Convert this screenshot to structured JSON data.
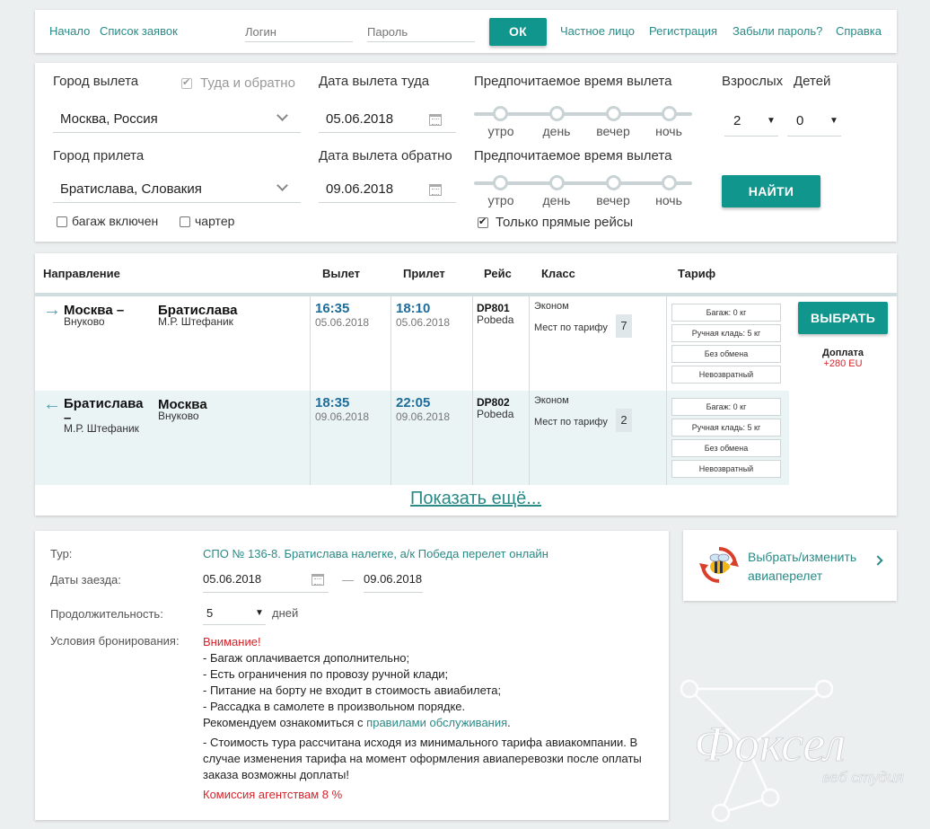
{
  "topbar": {
    "nav_home": "Начало",
    "nav_orders": "Список заявок",
    "login_placeholder": "Логин",
    "password_placeholder": "Пароль",
    "ok_label": "ОК",
    "private_person": "Частное лицо",
    "register": "Регистрация",
    "forgot": "Забыли пароль?",
    "help": "Справка"
  },
  "search": {
    "from_label": "Город вылета",
    "roundtrip_label": "Туда и обратно",
    "from_value": "Москва, Россия",
    "to_label": "Город прилета",
    "to_value": "Братислава, Словакия",
    "baggage_label": "багаж включен",
    "charter_label": "чартер",
    "depart_date_label": "Дата вылета туда",
    "depart_date": "05.06.2018",
    "return_date_label": "Дата вылета обратно",
    "return_date": "09.06.2018",
    "pref_time_label_1": "Предпочитаемое время вылета",
    "pref_time_label_2": "Предпочитаемое время вылета",
    "time_ticks": [
      "утро",
      "день",
      "вечер",
      "ночь"
    ],
    "direct_only_label": "Только прямые рейсы",
    "adults_label": "Взрослых",
    "adults_value": "2",
    "children_label": "Детей",
    "children_value": "0",
    "find_button": "НАЙТИ"
  },
  "results": {
    "headers": {
      "direction": "Направление",
      "departure": "Вылет",
      "arrival": "Прилет",
      "flight": "Рейс",
      "class": "Класс",
      "fare": "Тариф"
    },
    "rows": [
      {
        "arrow": "→",
        "from_city": "Москва –",
        "from_airport": "Внуково",
        "to_city": "Братислава",
        "to_airport": "М.Р. Штефаник",
        "dep_time": "16:35",
        "dep_date": "05.06.2018",
        "arr_time": "18:10",
        "arr_date": "05.06.2018",
        "flight_no": "DP801",
        "airline": "Pobeda",
        "class": "Эконом",
        "seats_label": "Мест по тарифу",
        "seats": "7",
        "fares": [
          "Багаж: 0 кг",
          "Ручная кладь: 5 кг",
          "Без обмена",
          "Невозвратный"
        ]
      },
      {
        "arrow": "←",
        "from_city": "Братислава –",
        "from_airport": "М.Р. Штефаник",
        "to_city": "Москва",
        "to_airport": "Внуково",
        "dep_time": "18:35",
        "dep_date": "09.06.2018",
        "arr_time": "22:05",
        "arr_date": "09.06.2018",
        "flight_no": "DP802",
        "airline": "Pobeda",
        "class": "Эконом",
        "seats_label": "Мест по тарифу",
        "seats": "2",
        "fares": [
          "Багаж: 0 кг",
          "Ручная кладь: 5 кг",
          "Без обмена",
          "Невозвратный"
        ]
      }
    ],
    "select_button": "ВЫБРАТЬ",
    "surcharge_label": "Доплата",
    "surcharge_value": "+280 EU",
    "show_more": "Показать ещё..."
  },
  "tour": {
    "tour_label": "Тур:",
    "tour_value": "СПО № 136-8. Братислава налегке, а/к Победа перелет онлайн",
    "dates_label": "Даты заезда:",
    "date_from": "05.06.2018",
    "dash": "—",
    "date_to": "09.06.2018",
    "duration_label": "Продолжительность:",
    "duration_value": "5",
    "duration_unit": "дней",
    "conditions_label": "Условия бронирования:",
    "attention": "Внимание!",
    "lines": [
      "- Багаж оплачивается дополнительно;",
      "- Есть ограничения по провозу ручной клади;",
      "- Питание на борту не входит в стоимость авиабилета;",
      "- Рассадка в самолете в произвольном порядке."
    ],
    "recommend_prefix": "Рекомендуем ознакомиться с ",
    "recommend_link": "правилами обслуживания",
    "recommend_suffix": ".",
    "cost_lines": [
      "- Стоимость тура рассчитана исходя из минимального тарифа авиакомпании. В",
      "случае изменения тарифа на момент оформления авиаперевозки после оплаты",
      "заказа возможны доплаты!"
    ],
    "commission": "Комиссия агентствам 8 %"
  },
  "side_card": {
    "line1": "Выбрать/изменить",
    "line2": "авиаперелет"
  },
  "watermark": {
    "brand": "Фоксел",
    "tagline": "веб студия"
  },
  "colors": {
    "accent": "#11968d",
    "time_blue": "#1d6c9a",
    "link_teal": "#2a8a86",
    "warning_red": "#d4232a",
    "row_alt_bg": "#eaf4f5"
  }
}
